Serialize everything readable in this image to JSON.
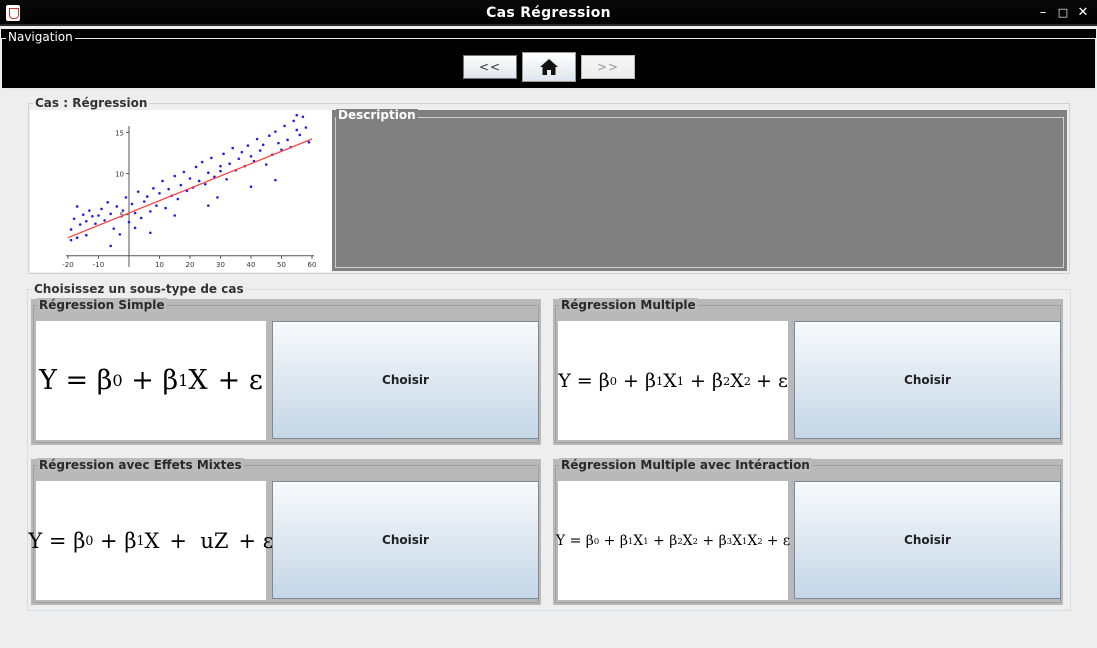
{
  "window": {
    "title": "Cas Régression"
  },
  "navigation": {
    "legend": "Navigation",
    "prev_label": "<<",
    "next_label": ">>"
  },
  "cas": {
    "legend": "Cas : Régression",
    "description_legend": "Description",
    "plot": {
      "type": "scatter",
      "x_ticks": [
        "-20",
        "-10",
        "10",
        "20",
        "30",
        "40",
        "50",
        "60"
      ],
      "y_ticks": [
        "15",
        "10",
        "5"
      ],
      "xlim": [
        -20,
        60
      ],
      "ylim": [
        -1,
        17
      ],
      "point_color": "#1f1fe0",
      "line_color": "#ff4040",
      "fit_line": {
        "x": [
          -20,
          60
        ],
        "y": [
          2.2,
          14.2
        ]
      },
      "points": [
        [
          -19,
          3.2
        ],
        [
          -18,
          4.5
        ],
        [
          -17,
          6
        ],
        [
          -16,
          3.8
        ],
        [
          -15,
          5
        ],
        [
          -14,
          4.2
        ],
        [
          -13,
          5.5
        ],
        [
          -12,
          4.8
        ],
        [
          -11,
          3.9
        ],
        [
          -10,
          4.9
        ],
        [
          -9,
          5.7
        ],
        [
          -8,
          4.3
        ],
        [
          -7,
          6.5
        ],
        [
          -6,
          5.1
        ],
        [
          -5,
          3.3
        ],
        [
          -4,
          6
        ],
        [
          -3,
          2.6
        ],
        [
          -2,
          5.5
        ],
        [
          -1,
          7.1
        ],
        [
          0,
          4.1
        ],
        [
          1,
          6.3
        ],
        [
          2,
          5.2
        ],
        [
          3,
          7.8
        ],
        [
          4,
          4.6
        ],
        [
          5,
          6.6
        ],
        [
          6,
          7.2
        ],
        [
          7,
          5.4
        ],
        [
          8,
          8.2
        ],
        [
          9,
          6.1
        ],
        [
          10,
          7.6
        ],
        [
          11,
          9.1
        ],
        [
          12,
          5.8
        ],
        [
          13,
          8.1
        ],
        [
          14,
          7.3
        ],
        [
          15,
          9.7
        ],
        [
          16,
          6.9
        ],
        [
          17,
          8.6
        ],
        [
          18,
          10.2
        ],
        [
          19,
          7.9
        ],
        [
          20,
          9.4
        ],
        [
          21,
          8.3
        ],
        [
          22,
          10.8
        ],
        [
          23,
          9.1
        ],
        [
          24,
          11.4
        ],
        [
          25,
          8.7
        ],
        [
          26,
          10.1
        ],
        [
          27,
          11.9
        ],
        [
          28,
          9.6
        ],
        [
          29,
          7.1
        ],
        [
          30,
          10.9
        ],
        [
          31,
          12.4
        ],
        [
          32,
          9.3
        ],
        [
          33,
          11.2
        ],
        [
          34,
          13.1
        ],
        [
          35,
          10.4
        ],
        [
          36,
          11.8
        ],
        [
          37,
          12.6
        ],
        [
          38,
          10.9
        ],
        [
          39,
          13.4
        ],
        [
          40,
          12.1
        ],
        [
          41,
          11.5
        ],
        [
          42,
          14.2
        ],
        [
          43,
          12.8
        ],
        [
          44,
          13.5
        ],
        [
          45,
          11.1
        ],
        [
          46,
          14.6
        ],
        [
          47,
          12.3
        ],
        [
          48,
          15.1
        ],
        [
          49,
          13.7
        ],
        [
          50,
          12.9
        ],
        [
          51,
          15.8
        ],
        [
          52,
          14.1
        ],
        [
          53,
          13.2
        ],
        [
          54,
          16.4
        ],
        [
          55,
          15.3
        ],
        [
          56,
          14.7
        ],
        [
          57,
          16.9
        ],
        [
          58,
          15.6
        ],
        [
          59,
          13.8
        ],
        [
          -17,
          2.2
        ],
        [
          -14,
          2.5
        ],
        [
          7,
          2.8
        ],
        [
          26,
          6.1
        ],
        [
          40,
          8.4
        ],
        [
          48,
          9.2
        ],
        [
          2,
          3.4
        ],
        [
          -6,
          1.2
        ],
        [
          15,
          4.9
        ],
        [
          30,
          10.3
        ],
        [
          -19,
          1.9
        ],
        [
          55,
          17.1
        ]
      ]
    }
  },
  "sous_types": {
    "legend": "Choisissez un sous-type de cas",
    "cards": [
      {
        "title": "Régression Simple",
        "button_label": "Choisir"
      },
      {
        "title": "Régression Multiple",
        "button_label": "Choisir"
      },
      {
        "title": "Régression avec Effets Mixtes",
        "button_label": "Choisir"
      },
      {
        "title": "Régression Multiple avec Intéraction",
        "button_label": "Choisir"
      }
    ],
    "formulas": {
      "simple": {
        "y": "Y",
        "eq": " = ",
        "b": "β",
        "b0": "0",
        "plus": " + ",
        "b1": "1",
        "x": "X",
        "eps": "+ ε"
      },
      "multiple": {
        "y": "Y",
        "eq": " = ",
        "b": "β",
        "b0": "0",
        "plus": " + ",
        "b1": "1",
        "x": "X",
        "x1": "1",
        "b2": "2",
        "x2": "2",
        "eps": "+ ε"
      },
      "mixed": {
        "y": "Y",
        "eq": " = ",
        "b": "β",
        "b0": "0",
        "plus": " + ",
        "b1": "1",
        "x": "X",
        "u": "+  uZ",
        "eps": "+ ε"
      },
      "interaction": {
        "y": "Y",
        "eq": " = ",
        "b": "β",
        "b0": "0",
        "plus": " + ",
        "b1": "1",
        "x": "X",
        "x1": "1",
        "b2": "2",
        "x2": "2",
        "b3": "3",
        "eps": "+ ε"
      }
    }
  }
}
